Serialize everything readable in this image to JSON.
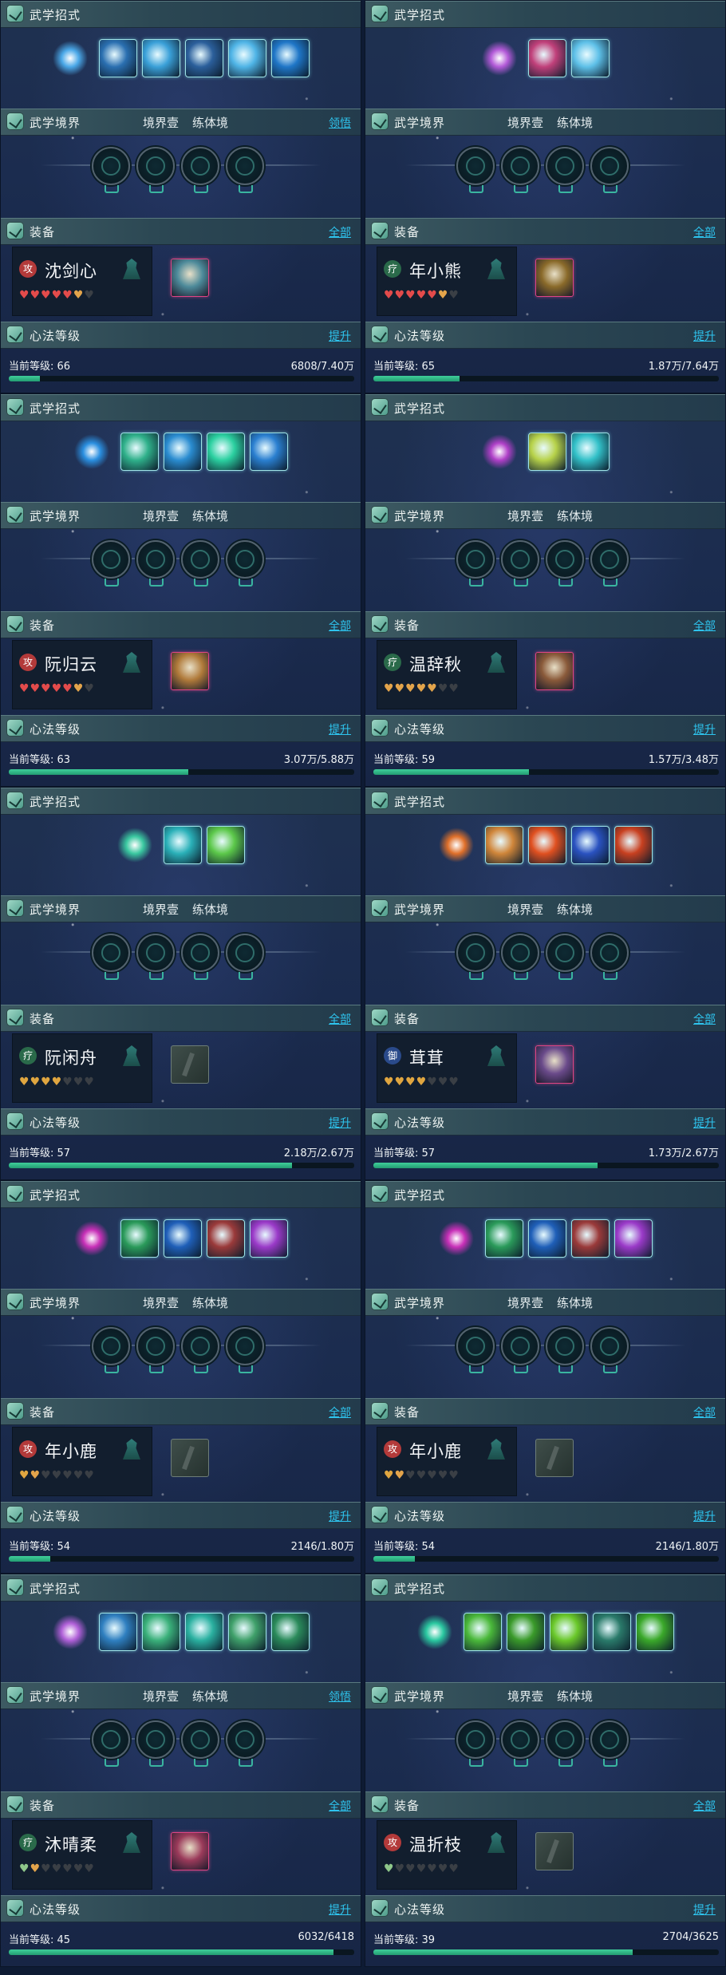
{
  "labels": {
    "martial_moves": "武学招式",
    "martial_realm": "武学境界",
    "equipment": "装备",
    "mind_level": "心法等级",
    "all": "全部",
    "upgrade": "提升",
    "comprehend": "领悟",
    "realm_one": "境界壹",
    "body_training": "练体境"
  },
  "cards": [
    {
      "name": "沈剑心",
      "badge": "攻",
      "badge_color": "#b33a3a",
      "level_text": "当前等级: 66",
      "progress_text": "6808/7.40万",
      "progress": 0.09,
      "hearts": [
        "full",
        "full",
        "full",
        "full",
        "full",
        "half",
        "empty"
      ],
      "realm_link": "comprehend",
      "realm_labels": false,
      "skill_count": 5,
      "skill_colors": [
        "#2a6fb0",
        "#3aa0d8",
        "#2b5f9b",
        "#4fb4e6",
        "#1f76c7"
      ],
      "orb_color": "#4aa8e8",
      "gear": "has",
      "gear_color": "#4d8a9a"
    },
    {
      "name": "年小熊",
      "badge": "疗",
      "badge_color": "#2a6a4a",
      "level_text": "当前等级: 65",
      "progress_text": "1.87万/7.64万",
      "progress": 0.25,
      "hearts": [
        "full",
        "full",
        "full",
        "full",
        "full",
        "half",
        "empty"
      ],
      "realm_link": "",
      "realm_labels": true,
      "skill_count": 2,
      "skill_colors": [
        "#c0407a",
        "#5ec0e8"
      ],
      "orb_color": "#b35ad8",
      "gear": "has",
      "gear_color": "#8a6a2a"
    },
    {
      "name": "阮归云",
      "badge": "攻",
      "badge_color": "#b33a3a",
      "level_text": "当前等级: 63",
      "progress_text": "3.07万/5.88万",
      "progress": 0.52,
      "hearts": [
        "full",
        "full",
        "full",
        "full",
        "full",
        "half",
        "empty"
      ],
      "realm_link": "",
      "realm_labels": true,
      "skill_count": 4,
      "skill_colors": [
        "#2fb08a",
        "#2a8cd0",
        "#2bd0a0",
        "#2a7fd0"
      ],
      "orb_color": "#2a8fe0",
      "gear": "has",
      "gear_color": "#b07a3a"
    },
    {
      "name": "温辞秋",
      "badge": "疗",
      "badge_color": "#2a6a4a",
      "level_text": "当前等级: 59",
      "progress_text": "1.57万/3.48万",
      "progress": 0.45,
      "hearts": [
        "half",
        "half",
        "half",
        "half",
        "half",
        "empty",
        "empty"
      ],
      "realm_link": "",
      "realm_labels": true,
      "skill_count": 2,
      "skill_colors": [
        "#b7d24a",
        "#32c0c8"
      ],
      "orb_color": "#b040c8",
      "gear": "has",
      "gear_color": "#8a5a3a"
    },
    {
      "name": "阮闲舟",
      "badge": "疗",
      "badge_color": "#2a6a4a",
      "level_text": "当前等级: 57",
      "progress_text": "2.18万/2.67万",
      "progress": 0.82,
      "hearts": [
        "gold",
        "gold",
        "gold",
        "gold",
        "empty",
        "empty",
        "empty"
      ],
      "realm_link": "",
      "realm_labels": true,
      "skill_count": 2,
      "skill_colors": [
        "#2ab0b8",
        "#5cc84a"
      ],
      "orb_color": "#3ac8a0",
      "gear": "none",
      "gear_color": ""
    },
    {
      "name": "茸茸",
      "badge": "御",
      "badge_color": "#2a4a8a",
      "level_text": "当前等级: 57",
      "progress_text": "1.73万/2.67万",
      "progress": 0.65,
      "hearts": [
        "gold",
        "gold",
        "gold",
        "gold",
        "empty",
        "empty",
        "empty"
      ],
      "realm_link": "",
      "realm_labels": true,
      "skill_count": 4,
      "skill_colors": [
        "#d0863a",
        "#e05020",
        "#2a52c0",
        "#c84020"
      ],
      "orb_color": "#e0702a",
      "gear": "has",
      "gear_color": "#6a4a8a"
    },
    {
      "name": "年小鹿",
      "badge": "攻",
      "badge_color": "#b33a3a",
      "level_text": "当前等级: 54",
      "progress_text": "2146/1.80万",
      "progress": 0.12,
      "hearts": [
        "gold",
        "half",
        "empty",
        "empty",
        "empty",
        "empty",
        "empty"
      ],
      "realm_link": "",
      "realm_labels": true,
      "skill_count": 4,
      "skill_colors": [
        "#2a9a5a",
        "#1f5fb8",
        "#9a3a3a",
        "#9a3ac8"
      ],
      "orb_color": "#c830b8",
      "gear": "none",
      "gear_color": ""
    },
    {
      "name": "年小鹿",
      "badge": "攻",
      "badge_color": "#b33a3a",
      "level_text": "当前等级: 54",
      "progress_text": "2146/1.80万",
      "progress": 0.12,
      "hearts": [
        "gold",
        "half",
        "empty",
        "empty",
        "empty",
        "empty",
        "empty"
      ],
      "realm_link": "",
      "realm_labels": true,
      "skill_count": 4,
      "skill_colors": [
        "#2a9a5a",
        "#1f5fb8",
        "#9a3a3a",
        "#9a3ac8"
      ],
      "orb_color": "#c830b8",
      "gear": "none",
      "gear_color": ""
    },
    {
      "name": "沐晴柔",
      "badge": "疗",
      "badge_color": "#2a6a4a",
      "level_text": "当前等级: 45",
      "progress_text": "6032/6418",
      "progress": 0.94,
      "hearts": [
        "green",
        "half",
        "empty",
        "empty",
        "empty",
        "empty",
        "empty"
      ],
      "realm_link": "comprehend",
      "realm_labels": true,
      "skill_count": 5,
      "skill_colors": [
        "#2f7fc0",
        "#3ab07a",
        "#2ab0a0",
        "#3fa06a",
        "#2a8a5a"
      ],
      "orb_color": "#b060d8",
      "gear": "has",
      "gear_color": "#9a3a5a"
    },
    {
      "name": "温折枝",
      "badge": "攻",
      "badge_color": "#b33a3a",
      "level_text": "当前等级: 39",
      "progress_text": "2704/3625",
      "progress": 0.75,
      "hearts": [
        "green",
        "empty",
        "empty",
        "empty",
        "empty",
        "empty",
        "empty"
      ],
      "realm_link": "",
      "realm_labels": true,
      "skill_count": 5,
      "skill_colors": [
        "#4ab83a",
        "#3a9a2a",
        "#6ac82a",
        "#2a7a6a",
        "#3aa82a"
      ],
      "orb_color": "#2ac8a0",
      "gear": "none",
      "gear_color": ""
    }
  ]
}
